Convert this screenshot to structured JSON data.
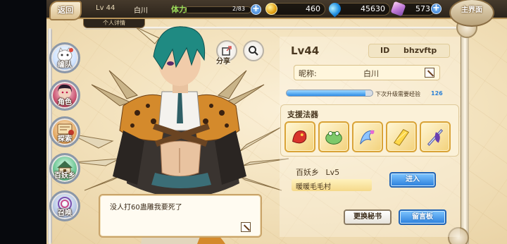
{
  "topbar": {
    "back_label": "返回",
    "level": "Lv 44",
    "player_name": "白川",
    "stamina_label": "体力",
    "stamina_text": "2/83",
    "stamina_fraction": 0.024,
    "gold": "460",
    "gems": "45630",
    "crystals": "573",
    "home_label": "主界面",
    "subtab": "个人详情"
  },
  "nav": {
    "items": [
      {
        "label": "编队",
        "icon": "ghost-cat-icon"
      },
      {
        "label": "角色",
        "icon": "character-portrait-icon"
      },
      {
        "label": "探索",
        "icon": "scroll-map-icon"
      },
      {
        "label": "百妖乡",
        "icon": "village-icon"
      },
      {
        "label": "召唤",
        "icon": "summon-icon"
      }
    ]
  },
  "actions": {
    "share_label": "分享"
  },
  "dialog": {
    "text": "没人打60蛊雕我要死了"
  },
  "profile": {
    "level": "Lv44",
    "id_label": "ID",
    "id_value": "bhzvftp",
    "nickname_label": "昵称:",
    "nickname_value": "白川",
    "exp_label": "下次升级需要经验",
    "exp_value": "126",
    "exp_fraction": 0.92,
    "support_title": "支援法器",
    "support_tools": [
      "red-dragon-tool-icon",
      "green-frog-tool-icon",
      "blue-swirl-tool-icon",
      "golden-wing-tool-icon",
      "purple-blade-tool-icon"
    ],
    "village_label": "百妖乡",
    "village_level": "Lv5",
    "village_name": "暖暖毛毛村",
    "enter_button": "进入",
    "change_secretary_button": "更换秘书",
    "message_board_button": "留言板"
  },
  "colors": {
    "accent_blue": "#2b7fdc",
    "panel_bg": "#fbf1d8",
    "text_brown": "#4a3820"
  }
}
